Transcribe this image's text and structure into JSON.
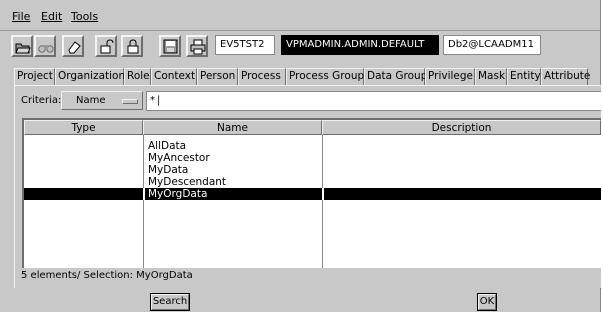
{
  "menubar": {
    "items": [
      "File",
      "Edit",
      "Tools"
    ]
  },
  "toolbar": {
    "icons": [
      "open-icon",
      "binoculars-icon",
      "eraser-icon",
      "unlock-icon",
      "lock-icon",
      "save-icon",
      "print-icon"
    ],
    "environment": "EV5TST2",
    "user": "VPMADMIN.ADMIN.DEFAULT",
    "database": "Db2@LCAADM11"
  },
  "tabs": [
    "Project",
    "Organization",
    "Role",
    "Context",
    "Person",
    "Process",
    "Process Group",
    "Data Group",
    "Privilege",
    "Mask",
    "Entity",
    "Attribute"
  ],
  "criteria": {
    "label": "Criteria:",
    "selected": "Name",
    "value": "*"
  },
  "table": {
    "columns": [
      "Type",
      "Name",
      "Description"
    ],
    "rows": [
      {
        "type": "",
        "name": "AllData",
        "description": ""
      },
      {
        "type": "",
        "name": "MyAncestor",
        "description": ""
      },
      {
        "type": "",
        "name": "MyData",
        "description": ""
      },
      {
        "type": "",
        "name": "MyDescendant",
        "description": ""
      },
      {
        "type": "",
        "name": "MyOrgData",
        "description": ""
      }
    ],
    "selected_index": 4
  },
  "status": "5 elements/ Selection: MyOrgData",
  "buttons": {
    "search": "Search",
    "ok": "OK"
  },
  "colors": {
    "window_bg": "#c8c8c8",
    "selection_bg": "#000000",
    "selection_fg": "#ffffff"
  }
}
